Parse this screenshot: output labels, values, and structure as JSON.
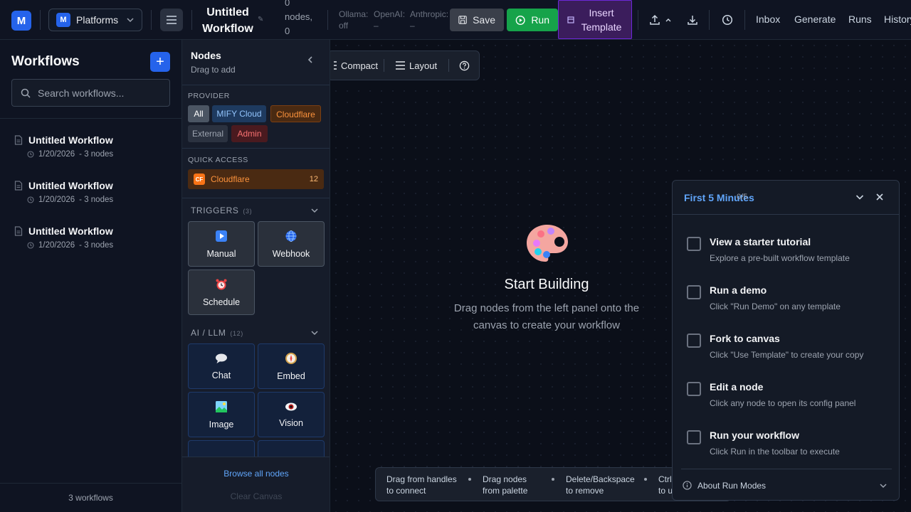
{
  "header": {
    "logo_letter": "M",
    "platform_letter": "M",
    "platform_label": "Platforms",
    "workflow_title_line1": "Untitled",
    "workflow_title_line2": "Workflow",
    "node_count_line1": "0",
    "node_count_line2": "nodes,",
    "node_count_line3": "0",
    "providers": [
      {
        "name": "Ollama:",
        "status": "off"
      },
      {
        "name": "OpenAI:",
        "status": "–"
      },
      {
        "name": "Anthropic:",
        "status": "–"
      }
    ],
    "save_label": "Save",
    "run_label": "Run",
    "insert_template_label": "Insert Template",
    "nav": [
      "Inbox",
      "Generate",
      "Runs",
      "History"
    ]
  },
  "sidebar": {
    "title": "Workflows",
    "add_label": "+",
    "search_placeholder": "Search workflows...",
    "workflows": [
      {
        "name": "Untitled Workflow",
        "date": "1/20/2026",
        "nodes": "- 3 nodes"
      },
      {
        "name": "Untitled Workflow",
        "date": "1/20/2026",
        "nodes": "- 3 nodes"
      },
      {
        "name": "Untitled Workflow",
        "date": "1/20/2026",
        "nodes": "- 3 nodes"
      }
    ],
    "footer": "3 workflows"
  },
  "nodes_panel": {
    "title": "Nodes",
    "subtitle": "Drag to add",
    "provider_label": "PROVIDER",
    "providers": {
      "all": "All",
      "mify": "MIFY Cloud",
      "cloudflare": "Cloudflare",
      "external": "External",
      "admin": "Admin"
    },
    "quick_access_label": "QUICK ACCESS",
    "quick_access": {
      "badge": "CF",
      "name": "Cloudflare",
      "count": "12"
    },
    "triggers_label": "TRIGGERS",
    "triggers_count": "(3)",
    "triggers": [
      {
        "label": "Manual",
        "icon": "play-icon"
      },
      {
        "label": "Webhook",
        "icon": "globe-icon"
      },
      {
        "label": "Schedule",
        "icon": "alarm-clock-icon"
      }
    ],
    "ai_label": "AI / LLM",
    "ai_count": "(12)",
    "ai_nodes": [
      {
        "label": "Chat",
        "icon": "speech-bubble-icon"
      },
      {
        "label": "Embed",
        "icon": "compass-icon"
      },
      {
        "label": "Image",
        "icon": "picture-icon"
      },
      {
        "label": "Vision",
        "icon": "eye-icon"
      }
    ],
    "browse_label": "Browse all nodes",
    "clear_label": "Clear Canvas"
  },
  "canvas": {
    "toolbar": {
      "compact": "Compact",
      "layout": "Layout"
    },
    "empty_title": "Start Building",
    "empty_desc_line1": "Drag nodes from the left panel onto the",
    "empty_desc_line2": "canvas to create your workflow",
    "hints": [
      {
        "line1": "Drag from handles",
        "line2": "to connect"
      },
      {
        "line1": "Drag nodes",
        "line2": "from palette"
      },
      {
        "line1": "Delete/Backspace",
        "line2": "to remove"
      },
      {
        "line1": "Ctrl",
        "line2": "to u"
      }
    ]
  },
  "onboarding": {
    "title": "First 5 Minutes",
    "progress": "0/5",
    "steps": [
      {
        "title": "View a starter tutorial",
        "desc": "Explore a pre-built workflow template"
      },
      {
        "title": "Run a demo",
        "desc": "Click \"Run Demo\" on any template"
      },
      {
        "title": "Fork to canvas",
        "desc": "Click \"Use Template\" to create your copy"
      },
      {
        "title": "Edit a node",
        "desc": "Click any node to open its config panel"
      },
      {
        "title": "Run your workflow",
        "desc": "Click Run in the toolbar to execute"
      }
    ],
    "footer": "About Run Modes"
  },
  "colors": {
    "accent": "#2563eb",
    "run": "#16a34a",
    "template": "#3b1d5c",
    "cloudflare": "#f97316",
    "link": "#60a5fa"
  }
}
